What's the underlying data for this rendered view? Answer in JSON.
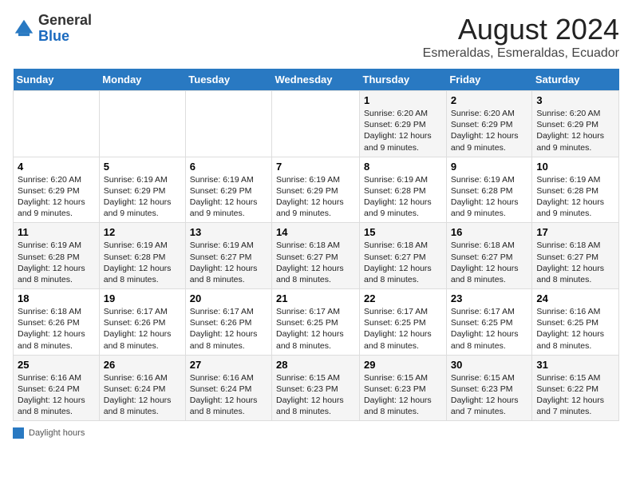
{
  "header": {
    "logo_general": "General",
    "logo_blue": "Blue",
    "main_title": "August 2024",
    "subtitle": "Esmeraldas, Esmeraldas, Ecuador"
  },
  "days_of_week": [
    "Sunday",
    "Monday",
    "Tuesday",
    "Wednesday",
    "Thursday",
    "Friday",
    "Saturday"
  ],
  "legend_label": "Daylight hours",
  "weeks": [
    [
      {
        "day": "",
        "info": ""
      },
      {
        "day": "",
        "info": ""
      },
      {
        "day": "",
        "info": ""
      },
      {
        "day": "",
        "info": ""
      },
      {
        "day": "1",
        "info": "Sunrise: 6:20 AM\nSunset: 6:29 PM\nDaylight: 12 hours and 9 minutes."
      },
      {
        "day": "2",
        "info": "Sunrise: 6:20 AM\nSunset: 6:29 PM\nDaylight: 12 hours and 9 minutes."
      },
      {
        "day": "3",
        "info": "Sunrise: 6:20 AM\nSunset: 6:29 PM\nDaylight: 12 hours and 9 minutes."
      }
    ],
    [
      {
        "day": "4",
        "info": "Sunrise: 6:20 AM\nSunset: 6:29 PM\nDaylight: 12 hours and 9 minutes."
      },
      {
        "day": "5",
        "info": "Sunrise: 6:19 AM\nSunset: 6:29 PM\nDaylight: 12 hours and 9 minutes."
      },
      {
        "day": "6",
        "info": "Sunrise: 6:19 AM\nSunset: 6:29 PM\nDaylight: 12 hours and 9 minutes."
      },
      {
        "day": "7",
        "info": "Sunrise: 6:19 AM\nSunset: 6:29 PM\nDaylight: 12 hours and 9 minutes."
      },
      {
        "day": "8",
        "info": "Sunrise: 6:19 AM\nSunset: 6:28 PM\nDaylight: 12 hours and 9 minutes."
      },
      {
        "day": "9",
        "info": "Sunrise: 6:19 AM\nSunset: 6:28 PM\nDaylight: 12 hours and 9 minutes."
      },
      {
        "day": "10",
        "info": "Sunrise: 6:19 AM\nSunset: 6:28 PM\nDaylight: 12 hours and 9 minutes."
      }
    ],
    [
      {
        "day": "11",
        "info": "Sunrise: 6:19 AM\nSunset: 6:28 PM\nDaylight: 12 hours and 8 minutes."
      },
      {
        "day": "12",
        "info": "Sunrise: 6:19 AM\nSunset: 6:28 PM\nDaylight: 12 hours and 8 minutes."
      },
      {
        "day": "13",
        "info": "Sunrise: 6:19 AM\nSunset: 6:27 PM\nDaylight: 12 hours and 8 minutes."
      },
      {
        "day": "14",
        "info": "Sunrise: 6:18 AM\nSunset: 6:27 PM\nDaylight: 12 hours and 8 minutes."
      },
      {
        "day": "15",
        "info": "Sunrise: 6:18 AM\nSunset: 6:27 PM\nDaylight: 12 hours and 8 minutes."
      },
      {
        "day": "16",
        "info": "Sunrise: 6:18 AM\nSunset: 6:27 PM\nDaylight: 12 hours and 8 minutes."
      },
      {
        "day": "17",
        "info": "Sunrise: 6:18 AM\nSunset: 6:27 PM\nDaylight: 12 hours and 8 minutes."
      }
    ],
    [
      {
        "day": "18",
        "info": "Sunrise: 6:18 AM\nSunset: 6:26 PM\nDaylight: 12 hours and 8 minutes."
      },
      {
        "day": "19",
        "info": "Sunrise: 6:17 AM\nSunset: 6:26 PM\nDaylight: 12 hours and 8 minutes."
      },
      {
        "day": "20",
        "info": "Sunrise: 6:17 AM\nSunset: 6:26 PM\nDaylight: 12 hours and 8 minutes."
      },
      {
        "day": "21",
        "info": "Sunrise: 6:17 AM\nSunset: 6:25 PM\nDaylight: 12 hours and 8 minutes."
      },
      {
        "day": "22",
        "info": "Sunrise: 6:17 AM\nSunset: 6:25 PM\nDaylight: 12 hours and 8 minutes."
      },
      {
        "day": "23",
        "info": "Sunrise: 6:17 AM\nSunset: 6:25 PM\nDaylight: 12 hours and 8 minutes."
      },
      {
        "day": "24",
        "info": "Sunrise: 6:16 AM\nSunset: 6:25 PM\nDaylight: 12 hours and 8 minutes."
      }
    ],
    [
      {
        "day": "25",
        "info": "Sunrise: 6:16 AM\nSunset: 6:24 PM\nDaylight: 12 hours and 8 minutes."
      },
      {
        "day": "26",
        "info": "Sunrise: 6:16 AM\nSunset: 6:24 PM\nDaylight: 12 hours and 8 minutes."
      },
      {
        "day": "27",
        "info": "Sunrise: 6:16 AM\nSunset: 6:24 PM\nDaylight: 12 hours and 8 minutes."
      },
      {
        "day": "28",
        "info": "Sunrise: 6:15 AM\nSunset: 6:23 PM\nDaylight: 12 hours and 8 minutes."
      },
      {
        "day": "29",
        "info": "Sunrise: 6:15 AM\nSunset: 6:23 PM\nDaylight: 12 hours and 8 minutes."
      },
      {
        "day": "30",
        "info": "Sunrise: 6:15 AM\nSunset: 6:23 PM\nDaylight: 12 hours and 7 minutes."
      },
      {
        "day": "31",
        "info": "Sunrise: 6:15 AM\nSunset: 6:22 PM\nDaylight: 12 hours and 7 minutes."
      }
    ]
  ]
}
